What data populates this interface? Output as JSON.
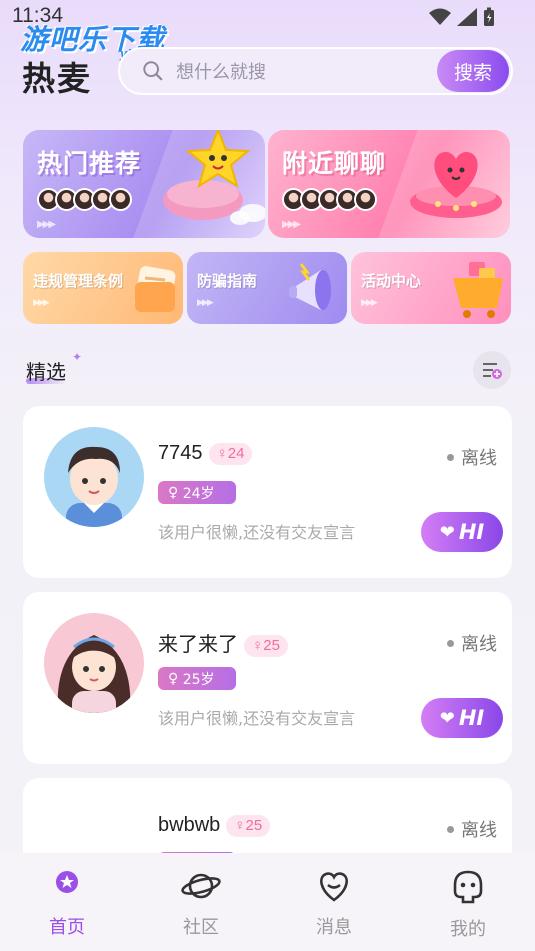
{
  "status_bar": {
    "time": "11:34"
  },
  "watermark": {
    "main": "游吧乐下载",
    "sub": "yBL.com"
  },
  "header": {
    "logo": "热麦",
    "search_placeholder": "想什么就搜",
    "search_button": "搜索"
  },
  "banners": [
    {
      "title": "热门推荐",
      "color": "#a88df0"
    },
    {
      "title": "附近聊聊",
      "color": "#ff7fae"
    }
  ],
  "small_banners": [
    {
      "title": "违规管理条例"
    },
    {
      "title": "防骗指南"
    },
    {
      "title": "活动中心"
    }
  ],
  "section": {
    "title": "精选"
  },
  "cards": [
    {
      "name": "7745",
      "gender_age": "24",
      "age_tag": "24岁",
      "desc": "该用户很懒,还没有交友宣言",
      "status": "离线",
      "hi": "HI"
    },
    {
      "name": "来了来了",
      "gender_age": "25",
      "age_tag": "25岁",
      "desc": "该用户很懒,还没有交友宣言",
      "status": "离线",
      "hi": "HI"
    },
    {
      "name": "bwbwb",
      "gender_age": "25",
      "status": "离线"
    }
  ],
  "tabs": [
    {
      "label": "首页",
      "icon": "home-icon",
      "active": true
    },
    {
      "label": "社区",
      "icon": "planet-icon"
    },
    {
      "label": "消息",
      "icon": "heart-chat-icon"
    },
    {
      "label": "我的",
      "icon": "profile-icon"
    }
  ],
  "accent_color": "#9a4fe8"
}
